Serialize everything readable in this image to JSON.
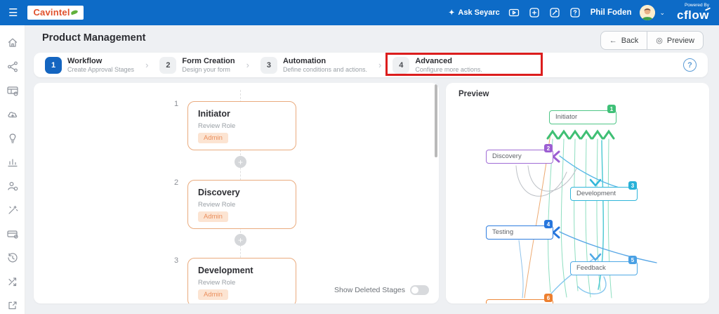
{
  "topbar": {
    "brand": "Cavintel",
    "ask_label": "Ask Seyarc",
    "user_name": "Phil Foden",
    "powered_by_label": "Powered By",
    "powered_by_brand": "cflow",
    "icon_names": [
      "menu-icon",
      "sparkle-icon",
      "video-demo-icon",
      "add-new-icon",
      "edit-notes-icon",
      "help-icon",
      "user-avatar",
      "dropdown-caret-icon"
    ]
  },
  "icons": {
    "menu": "☰",
    "sparkle": "✦",
    "back_arrow": "←",
    "preview_eye": "◎",
    "chevron": "›",
    "plus": "+",
    "caret_down": "⌄",
    "help": "?"
  },
  "header": {
    "title": "Product Management",
    "back_label": "Back",
    "preview_label": "Preview"
  },
  "stepper": {
    "active_step": 1,
    "annotated_step": 4,
    "steps": [
      {
        "num": "1",
        "title": "Workflow",
        "subtitle": "Create Approval Stages"
      },
      {
        "num": "2",
        "title": "Form Creation",
        "subtitle": "Design your form"
      },
      {
        "num": "3",
        "title": "Automation",
        "subtitle": "Define conditions and actions."
      },
      {
        "num": "4",
        "title": "Advanced",
        "subtitle": "Configure more actions."
      }
    ]
  },
  "sidebar": {
    "icon_names": [
      "home-icon",
      "share-network-icon",
      "process-table-icon",
      "cloud-upload-icon",
      "idea-bulb-icon",
      "analytics-chart-icon",
      "user-settings-icon",
      "magic-wand-icon",
      "card-settings-icon",
      "history-icon",
      "integration-arrows-icon",
      "external-edit-icon"
    ]
  },
  "stages": {
    "items": [
      {
        "num": "1",
        "title": "Initiator",
        "role_label": "Review Role",
        "role_value": "Admin"
      },
      {
        "num": "2",
        "title": "Discovery",
        "role_label": "Review Role",
        "role_value": "Admin"
      },
      {
        "num": "3",
        "title": "Development",
        "role_label": "Review Role",
        "role_value": "Admin"
      }
    ],
    "toggle_label": "Show Deleted Stages",
    "toggle_state": "off"
  },
  "preview": {
    "title": "Preview",
    "nodes": [
      {
        "label": "Initiator",
        "num": "1",
        "color": "#3fc077"
      },
      {
        "label": "Discovery",
        "num": "2",
        "color": "#9c5ed2"
      },
      {
        "label": "Development",
        "num": "3",
        "color": "#28b1d8"
      },
      {
        "label": "Testing",
        "num": "4",
        "color": "#2776dd"
      },
      {
        "label": "Feedback",
        "num": "5",
        "color": "#49a0e4"
      },
      {
        "label": "",
        "num": "6",
        "color": "#ed7f2f"
      }
    ]
  },
  "colors": {
    "topbar_blue": "#0d6bc7",
    "active_step_blue": "#1465c0",
    "annotation_red": "#dc1d1d",
    "stage_border_orange": "#eaab7e",
    "chip_bg": "#fce4d2",
    "chip_text": "#ea8f5d",
    "background": "#eef0f3"
  }
}
